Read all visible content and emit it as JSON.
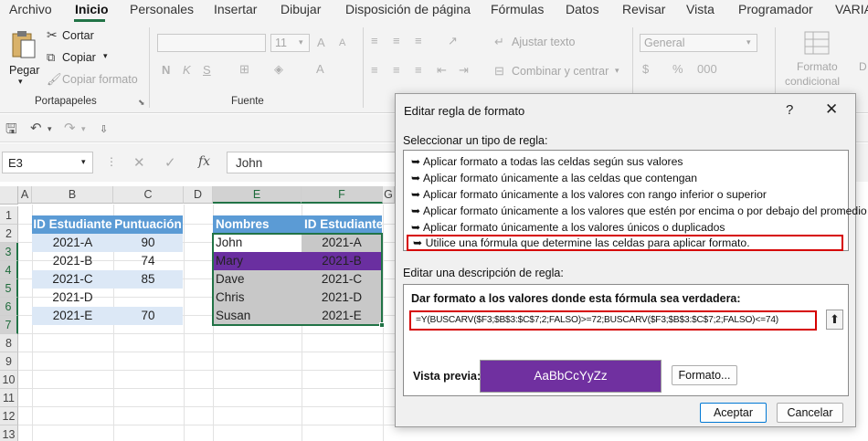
{
  "ribbon_tabs": [
    "Archivo",
    "Inicio",
    "Personales",
    "Insertar",
    "Dibujar",
    "Disposición de página",
    "Fórmulas",
    "Datos",
    "Revisar",
    "Vista",
    "Programador",
    "VARIA"
  ],
  "clipboard": {
    "paste_label": "Pegar",
    "cut_label": "Cortar",
    "copy_label": "Copiar",
    "format_painter_label": "Copiar formato",
    "group_label": "Portapapeles"
  },
  "font_group": {
    "size": "11",
    "label": "Fuente"
  },
  "alignment": {
    "wrap_label": "Ajustar texto",
    "merge_label": "Combinar y centrar"
  },
  "number": {
    "format": "General"
  },
  "conditional": {
    "line1": "Formato",
    "line2": "condicional"
  },
  "name_box": "E3",
  "formula_bar": {
    "fx": "fx",
    "value": "John"
  },
  "columns": [
    "A",
    "B",
    "C",
    "D",
    "E",
    "F",
    "G"
  ],
  "rows": [
    "1",
    "2",
    "3",
    "4",
    "5",
    "6",
    "7",
    "8",
    "9",
    "10",
    "11",
    "12",
    "13"
  ],
  "table1": {
    "headers": [
      "ID Estudiante",
      "Puntuación"
    ],
    "rows": [
      [
        "2021-A",
        "90"
      ],
      [
        "2021-B",
        "74"
      ],
      [
        "2021-C",
        "85"
      ],
      [
        "2021-D",
        ""
      ],
      [
        "2021-E",
        "70"
      ]
    ]
  },
  "table2": {
    "headers": [
      "Nombres",
      "ID Estudiante"
    ],
    "rows": [
      [
        "John",
        "2021-A"
      ],
      [
        "Mary",
        "2021-B"
      ],
      [
        "Dave",
        "2021-C"
      ],
      [
        "Chris",
        "2021-D"
      ],
      [
        "Susan",
        "2021-E"
      ]
    ],
    "highlight_color": "#7030a0"
  },
  "dialog": {
    "title": "Editar regla de formato",
    "help": "?",
    "close": "✕",
    "select_type_label": "Seleccionar un tipo de regla:",
    "rule_types": [
      "Aplicar formato a todas las celdas según sus valores",
      "Aplicar formato únicamente a las celdas que contengan",
      "Aplicar formato únicamente a los valores con rango inferior o superior",
      "Aplicar formato únicamente a los valores que estén por encima o por debajo del promedio",
      "Aplicar formato únicamente a los valores únicos o duplicados",
      "Utilice una fórmula que determine las celdas para aplicar formato."
    ],
    "edit_desc_label": "Editar una descripción de regla:",
    "formula_label": "Dar formato a los valores donde esta fórmula sea verdadera:",
    "formula": "=Y(BUSCARV($F3;$B$3:$C$7;2;FALSO)>=72;BUSCARV($F3;$B$3:$C$7;2;FALSO)<=74)",
    "preview_label": "Vista previa:",
    "preview_text": "AaBbCcYyZz",
    "preview_color": "#7030a0",
    "format_button": "Formato...",
    "ok_button": "Aceptar",
    "cancel_button": "Cancelar"
  }
}
